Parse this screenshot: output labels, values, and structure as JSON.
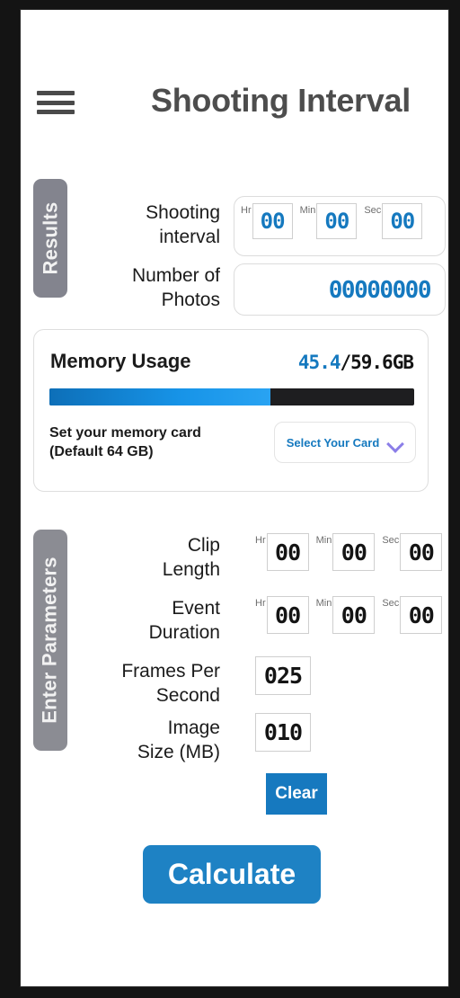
{
  "header": {
    "title": "Shooting Interval",
    "menu_icon": "hamburger-menu-icon"
  },
  "results": {
    "tab_label": "Results",
    "shooting_interval": {
      "label": "Shooting\ninterval",
      "label_line1": "Shooting",
      "label_line2": "interval",
      "units": [
        {
          "unit": "Hr",
          "value": "00"
        },
        {
          "unit": "Min",
          "value": "00"
        },
        {
          "unit": "Sec",
          "value": "00"
        }
      ]
    },
    "number_of_photos": {
      "label_line1": "Number of",
      "label_line2": "Photos",
      "value": "00000000"
    }
  },
  "memory": {
    "title": "Memory Usage",
    "used": "45.4",
    "separator_total": "/59.6GB",
    "total": "59.6GB",
    "bar_percent": 60.5,
    "hint_line1": "Set your memory card",
    "hint_line2": "(Default 64 GB)",
    "select_label": "Select Your Card",
    "select_icon": "chevron-down-icon",
    "colors": {
      "used_text": "#1579bf",
      "bar_fill_start": "#0d6fb8",
      "bar_fill_end": "#29a3f2",
      "bar_track": "#1e1e20",
      "chevron": "#8b7ee8"
    }
  },
  "parameters": {
    "tab_label": "Enter Parameters",
    "clip_length": {
      "label_line1": "Clip",
      "label_line2": "Length",
      "units": [
        {
          "unit": "Hr",
          "value": "00"
        },
        {
          "unit": "Min",
          "value": "00"
        },
        {
          "unit": "Sec",
          "value": "00"
        }
      ]
    },
    "event_duration": {
      "label_line1": "Event",
      "label_line2": "Duration",
      "units": [
        {
          "unit": "Hr",
          "value": "00"
        },
        {
          "unit": "Min",
          "value": "00"
        },
        {
          "unit": "Sec",
          "value": "00"
        }
      ]
    },
    "frames_per_second": {
      "label_line1": "Frames Per",
      "label_line2": "Second",
      "value": "025"
    },
    "image_size": {
      "label_line1": "Image",
      "label_line2": "Size (MB)",
      "value": "010"
    },
    "clear_label": "Clear"
  },
  "actions": {
    "calculate_label": "Calculate"
  },
  "colors": {
    "accent_blue": "#1e82c4",
    "tab_gray": "#83848e",
    "title_gray": "#4d4d4d"
  }
}
